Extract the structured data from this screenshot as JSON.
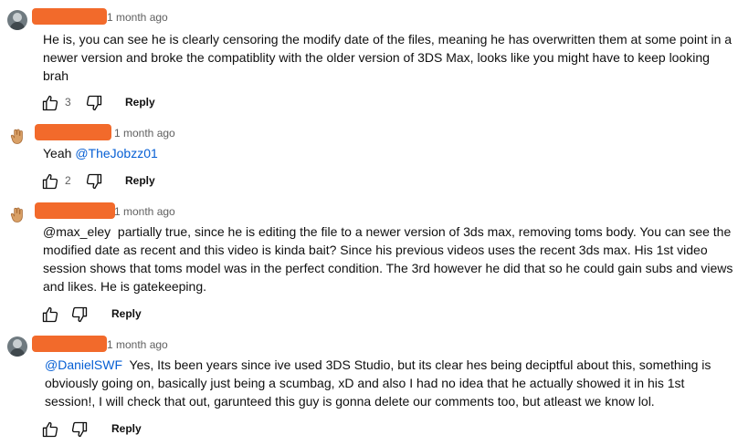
{
  "comments": [
    {
      "avatar": "person-avatar",
      "time": "1 month ago",
      "text": "He is, you can see he is clearly censoring the modify date of the files, meaning he has overwritten them at some point in a newer version and broke the compatiblity with the older version of 3DS Max, looks like you might have to keep looking brah",
      "mention": "",
      "like_count": "3",
      "reply_label": "Reply"
    },
    {
      "avatar": "hand-avatar",
      "time": "1 month ago",
      "text_before": "Yeah ",
      "mention": "@TheJobzz01",
      "like_count": "2",
      "reply_label": "Reply"
    },
    {
      "avatar": "hand-avatar",
      "time": "1 month ago",
      "mention": "@max_eley",
      "text": "  partially true, since he is editing the file to a newer version of 3ds max, removing toms body. You can see the modified date as recent and this video is kinda bait? Since his previous videos uses the recent 3ds max. His 1st video session shows that toms model was in the perfect condition. The 3rd however he did that so he could gain subs and views and likes. He is gatekeeping.",
      "like_count": "",
      "reply_label": "Reply"
    },
    {
      "avatar": "person-avatar",
      "time": "1 month ago",
      "mention": "@DanielSWF",
      "text": "  Yes, Its been years since ive used 3DS Studio, but its clear hes being deciptful about this, something is obviously going on, basically just being a scumbag, xD and also I had no idea that he actually showed it in his 1st session!, I will check that out, garunteed this guy is gonna delete our comments too, but atleast we know lol.",
      "like_count": "",
      "reply_label": "Reply"
    }
  ],
  "colors": {
    "redaction": "#f26a2b",
    "mention": "#065fd4",
    "meta": "#606060"
  }
}
